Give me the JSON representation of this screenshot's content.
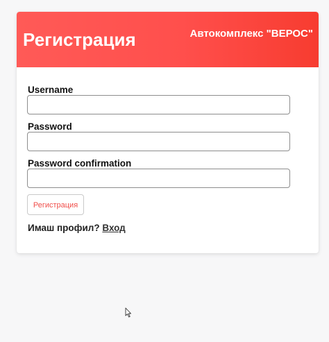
{
  "header": {
    "title": "Регистрация",
    "brand": "Автокомплекс \"ВЕРОС\""
  },
  "form": {
    "username": {
      "label": "Username",
      "value": ""
    },
    "password": {
      "label": "Password",
      "value": ""
    },
    "password_confirmation": {
      "label": "Password confirmation",
      "value": ""
    },
    "submit_label": "Регистрация"
  },
  "footer": {
    "question": "Имаш профил?",
    "login_link": "Вход"
  },
  "colors": {
    "accent": "#ff4f4c",
    "button_text": "#f04e4a",
    "background": "#f7f7f8"
  },
  "icons": {
    "cursor": "mouse-pointer-icon"
  }
}
